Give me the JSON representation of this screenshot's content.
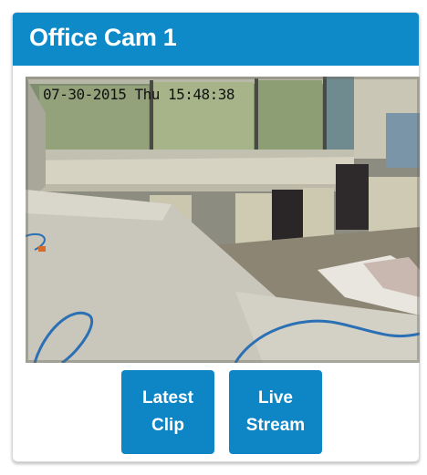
{
  "camera": {
    "title": "Office Cam 1",
    "timestamp": "07-30-2015 Thu 15:48:38"
  },
  "actions": {
    "latest_clip": {
      "line1": "Latest",
      "line2": "Clip"
    },
    "live_stream": {
      "line1": "Live",
      "line2": "Stream"
    }
  },
  "colors": {
    "accent": "#0e8ac8",
    "button": "#0e86c6"
  }
}
